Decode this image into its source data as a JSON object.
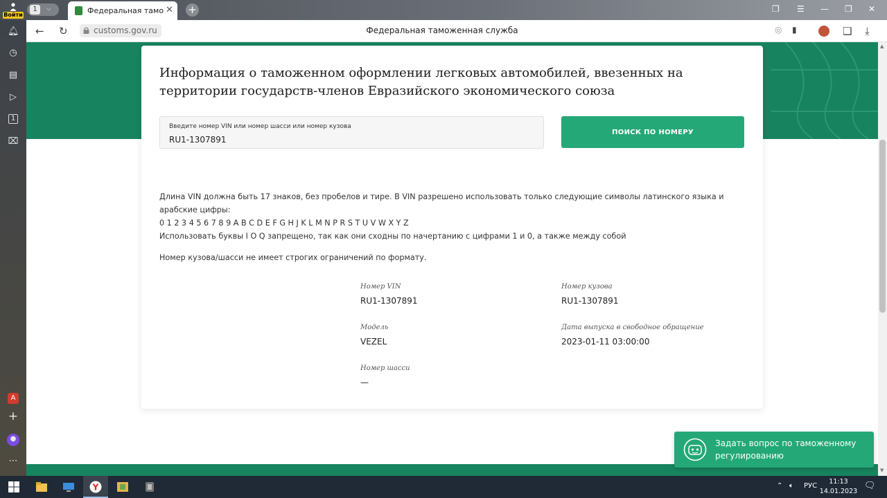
{
  "browser": {
    "login_label": "Войти",
    "tab_count": "1",
    "tab_title": "Федеральная таможенная служба",
    "url": "customs.gov.ru",
    "page_title": "Федеральная таможенная служба",
    "sidebar_badge": "1"
  },
  "page": {
    "heading": "Информация о таможенном оформлении легковых автомобилей, ввезенных на территории государств-членов Евразийского экономического союза",
    "vin_input_label": "Введите номер VIN или номер шасси или номер кузова",
    "vin_input_value": "RU1-1307891",
    "search_button": "ПОИСК ПО НОМЕРУ",
    "rules": {
      "line1": "Длина VIN должна быть 17 знаков, без пробелов и тире. В VIN разрешено использовать только следующие символы латинского языка и арабские цифры:",
      "line2": "0 1 2 3 4 5 6 7 8 9 A B C D E F G H J K L M N P R S T U V W X Y Z",
      "line3": "Использовать буквы I O Q запрещено, так как они сходны по начертанию с цифрами 1 и 0, а также между собой",
      "line4": "Номер кузова/шасси не имеет строгих ограничений по формату."
    },
    "results": {
      "vin": {
        "label": "Номер VIN",
        "value": "RU1-1307891"
      },
      "body": {
        "label": "Номер кузова",
        "value": "RU1-1307891"
      },
      "model": {
        "label": "Модель",
        "value": "VEZEL"
      },
      "release_date": {
        "label": "Дата выпуска в свободное обращение",
        "value": "2023-01-11 03:00:00"
      },
      "chassis": {
        "label": "Номер шасси",
        "value": "—"
      }
    },
    "chat_widget": "Задать вопрос по таможенному регулированию"
  },
  "taskbar": {
    "language": "РУС",
    "time": "11:13",
    "date": "14.01.2023"
  },
  "colors": {
    "brand_green": "#17845f",
    "button_green": "#24a877"
  }
}
